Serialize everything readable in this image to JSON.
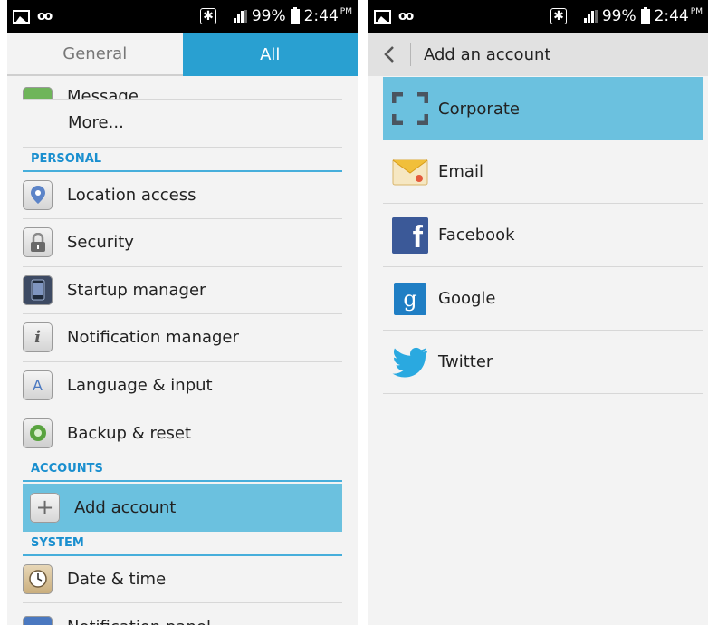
{
  "status_bar": {
    "battery": "99%",
    "time": "2:44",
    "ampm": "PM",
    "icons": [
      "image-icon",
      "voicemail-icon",
      "bluetooth-icon",
      "signal-icon",
      "battery-icon"
    ]
  },
  "settings": {
    "tabs": [
      {
        "label": "General",
        "selected": false
      },
      {
        "label": "All",
        "selected": true
      }
    ],
    "partial_top_item": "Message",
    "more_item": "More...",
    "sections": {
      "personal": "PERSONAL",
      "accounts": "ACCOUNTS",
      "system": "SYSTEM"
    },
    "personal_items": [
      {
        "label": "Location access",
        "icon": "location-pin-icon"
      },
      {
        "label": "Security",
        "icon": "padlock-icon"
      },
      {
        "label": "Startup manager",
        "icon": "phone-manager-icon"
      },
      {
        "label": "Notification manager",
        "icon": "info-icon"
      },
      {
        "label": "Language & input",
        "icon": "letter-a-icon"
      },
      {
        "label": "Backup & reset",
        "icon": "backup-icon"
      }
    ],
    "account_items": [
      {
        "label": "Add account",
        "icon": "plus-icon",
        "selected": true
      }
    ],
    "system_items": [
      {
        "label": "Date & time",
        "icon": "clock-icon"
      }
    ],
    "partial_bottom_item": "Notification panel"
  },
  "add_account": {
    "title": "Add an account",
    "items": [
      {
        "label": "Corporate",
        "icon": "corporate-brackets-icon",
        "selected": true
      },
      {
        "label": "Email",
        "icon": "email-envelope-icon"
      },
      {
        "label": "Facebook",
        "icon": "facebook-icon"
      },
      {
        "label": "Google",
        "icon": "google-icon"
      },
      {
        "label": "Twitter",
        "icon": "twitter-bird-icon"
      }
    ]
  },
  "colors": {
    "tab_selected": "#29a0d1",
    "selected_row": "#6bc1df",
    "section_header": "#1a8fcf",
    "facebook": "#3b5998",
    "google": "#1f7ec4",
    "twitter": "#2aa9e0"
  }
}
